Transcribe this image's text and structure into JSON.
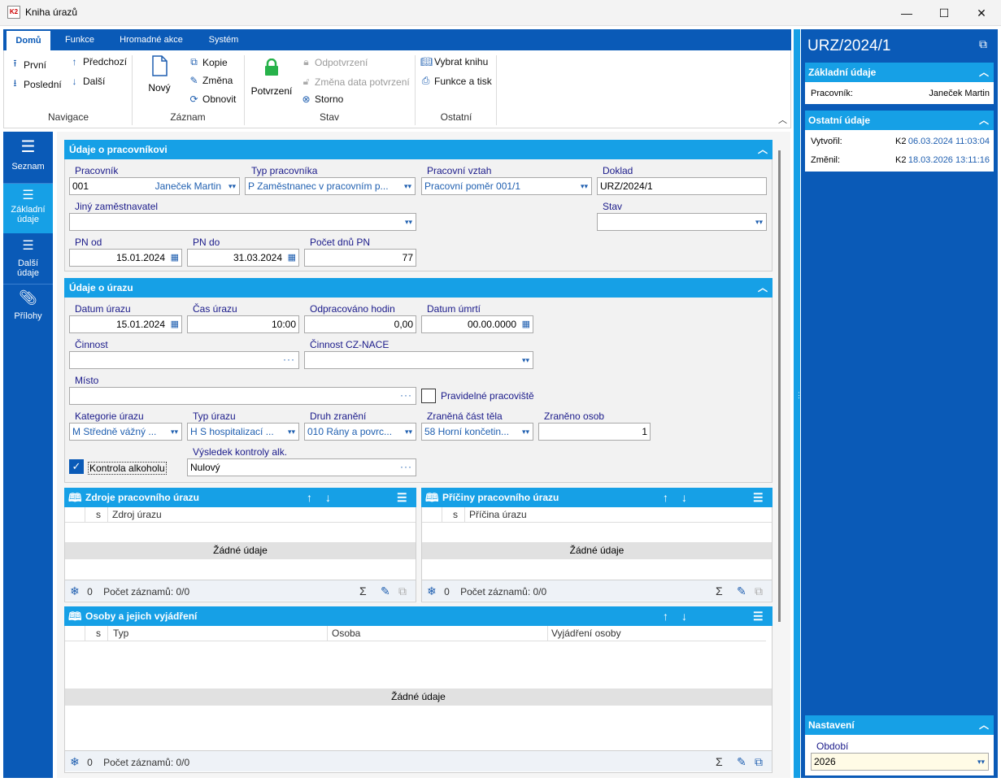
{
  "window": {
    "icon_text": "K2",
    "title": "Kniha úrazů",
    "minimize": "—",
    "maximize": "☐",
    "close": "✕"
  },
  "ribbon": {
    "tabs": [
      "Domů",
      "Funkce",
      "Hromadné akce",
      "Systém"
    ],
    "groups": {
      "navigace": {
        "label": "Navigace",
        "prvni": "První",
        "predchozi": "Předchozí",
        "posledni": "Poslední",
        "dalsi": "Další"
      },
      "zaznam": {
        "label": "Záznam",
        "novy": "Nový",
        "kopie": "Kopie",
        "zmena": "Změna",
        "obnovit": "Obnovit"
      },
      "stav": {
        "label": "Stav",
        "potvrzeni": "Potvrzení",
        "odpotvrzeni": "Odpotvrzení",
        "zmena_data": "Změna data potvrzení",
        "storno": "Storno"
      },
      "ostatni": {
        "label": "Ostatní",
        "vybrat_knihu": "Vybrat knihu",
        "funkce_tisk": "Funkce a tisk"
      }
    }
  },
  "leftnav": {
    "items": [
      {
        "label": "Seznam",
        "label2": ""
      },
      {
        "label": "Základní",
        "label2": "údaje"
      },
      {
        "label": "Další",
        "label2": "údaje"
      },
      {
        "label": "Přílohy",
        "label2": ""
      }
    ]
  },
  "pracovnik_section": {
    "title": "Údaje o pracovníkovi",
    "pracovnik_label": "Pracovník",
    "pracovnik_code": "001",
    "pracovnik_name": "Janeček Martin",
    "typ_label": "Typ pracovníka",
    "typ_value": "P  Zaměstnanec v pracovním p...",
    "vztah_label": "Pracovní vztah",
    "vztah_value": "Pracovní poměr 001/1",
    "doklad_label": "Doklad",
    "doklad_value": "URZ/2024/1",
    "jiny_label": "Jiný zaměstnavatel",
    "jiny_value": "",
    "stav_label": "Stav",
    "stav_value": "",
    "pn_od_label": "PN od",
    "pn_od_value": "15.01.2024",
    "pn_do_label": "PN do",
    "pn_do_value": "31.03.2024",
    "pocet_label": "Počet dnů PN",
    "pocet_value": "77"
  },
  "uraz_section": {
    "title": "Údaje o úrazu",
    "datum_label": "Datum úrazu",
    "datum_value": "15.01.2024",
    "cas_label": "Čas úrazu",
    "cas_value": "10:00",
    "odprac_label": "Odpracováno hodin",
    "odprac_value": "0,00",
    "umrti_label": "Datum úmrtí",
    "umrti_value": "00.00.0000",
    "cinnost_label": "Činnost",
    "cinnost_value": "",
    "nace_label": "Činnost CZ-NACE",
    "nace_value": "",
    "misto_label": "Místo",
    "misto_value": "",
    "pravidelne_label": "Pravidelné pracoviště",
    "kategorie_label": "Kategorie úrazu",
    "kategorie_value": "M  Středně vážný ...",
    "typ_label": "Typ úrazu",
    "typ_value": "H  S hospitalizací ...",
    "druh_label": "Druh zranění",
    "druh_value": "010  Rány a povrc...",
    "cast_label": "Zraněná část těla",
    "cast_value": "58  Horní končetin...",
    "osob_label": "Zraněno osob",
    "osob_value": "1",
    "alkohol_label": "Kontrola alkoholu",
    "vysledek_label": "Výsledek kontroly alk.",
    "vysledek_value": "Nulový"
  },
  "zdroje": {
    "title": "Zdroje pracovního úrazu",
    "col_s": "s",
    "col_main": "Zdroj úrazu",
    "nodata": "Žádné údaje",
    "count": "0",
    "records": "Počet záznamů: 0/0"
  },
  "priciny": {
    "title": "Příčiny pracovního úrazu",
    "col_s": "s",
    "col_main": "Příčina úrazu",
    "nodata": "Žádné údaje",
    "count": "0",
    "records": "Počet záznamů: 0/0"
  },
  "osoby": {
    "title": "Osoby a jejich vyjádření",
    "col_s": "s",
    "col_typ": "Typ",
    "col_osoba": "Osoba",
    "col_vyj": "Vyjádření osoby",
    "nodata": "Žádné údaje",
    "count": "0",
    "records": "Počet záznamů: 0/0"
  },
  "right": {
    "title": "URZ/2024/1",
    "zakladni_title": "Základní údaje",
    "pracovnik_label": "Pracovník:",
    "pracovnik_value": "Janeček Martin",
    "ostatni_title": "Ostatní údaje",
    "vytvoril_label": "Vytvořil:",
    "vytvoril_user": "K2",
    "vytvoril_date": "06.03.2024 11:03:04",
    "zmenil_label": "Změnil:",
    "zmenil_user": "K2",
    "zmenil_date": "18.03.2026 13:11:16",
    "nastaveni_title": "Nastavení",
    "obdobi_label": "Období",
    "obdobi_value": "2026"
  },
  "colors": {
    "accent": "#16a0e6",
    "dark": "#0a5ab7"
  }
}
